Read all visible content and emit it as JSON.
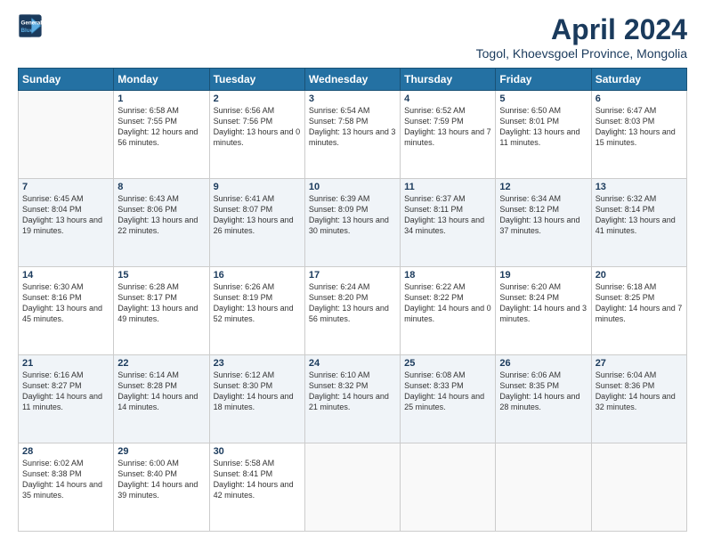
{
  "header": {
    "logo_line1": "General",
    "logo_line2": "Blue",
    "title": "April 2024",
    "subtitle": "Togol, Khoevsgoel Province, Mongolia"
  },
  "days_of_week": [
    "Sunday",
    "Monday",
    "Tuesday",
    "Wednesday",
    "Thursday",
    "Friday",
    "Saturday"
  ],
  "weeks": [
    [
      {
        "day": null
      },
      {
        "day": "1",
        "sunrise": "6:58 AM",
        "sunset": "7:55 PM",
        "daylight": "12 hours and 56 minutes."
      },
      {
        "day": "2",
        "sunrise": "6:56 AM",
        "sunset": "7:56 PM",
        "daylight": "13 hours and 0 minutes."
      },
      {
        "day": "3",
        "sunrise": "6:54 AM",
        "sunset": "7:58 PM",
        "daylight": "13 hours and 3 minutes."
      },
      {
        "day": "4",
        "sunrise": "6:52 AM",
        "sunset": "7:59 PM",
        "daylight": "13 hours and 7 minutes."
      },
      {
        "day": "5",
        "sunrise": "6:50 AM",
        "sunset": "8:01 PM",
        "daylight": "13 hours and 11 minutes."
      },
      {
        "day": "6",
        "sunrise": "6:47 AM",
        "sunset": "8:03 PM",
        "daylight": "13 hours and 15 minutes."
      }
    ],
    [
      {
        "day": "7",
        "sunrise": "6:45 AM",
        "sunset": "8:04 PM",
        "daylight": "13 hours and 19 minutes."
      },
      {
        "day": "8",
        "sunrise": "6:43 AM",
        "sunset": "8:06 PM",
        "daylight": "13 hours and 22 minutes."
      },
      {
        "day": "9",
        "sunrise": "6:41 AM",
        "sunset": "8:07 PM",
        "daylight": "13 hours and 26 minutes."
      },
      {
        "day": "10",
        "sunrise": "6:39 AM",
        "sunset": "8:09 PM",
        "daylight": "13 hours and 30 minutes."
      },
      {
        "day": "11",
        "sunrise": "6:37 AM",
        "sunset": "8:11 PM",
        "daylight": "13 hours and 34 minutes."
      },
      {
        "day": "12",
        "sunrise": "6:34 AM",
        "sunset": "8:12 PM",
        "daylight": "13 hours and 37 minutes."
      },
      {
        "day": "13",
        "sunrise": "6:32 AM",
        "sunset": "8:14 PM",
        "daylight": "13 hours and 41 minutes."
      }
    ],
    [
      {
        "day": "14",
        "sunrise": "6:30 AM",
        "sunset": "8:16 PM",
        "daylight": "13 hours and 45 minutes."
      },
      {
        "day": "15",
        "sunrise": "6:28 AM",
        "sunset": "8:17 PM",
        "daylight": "13 hours and 49 minutes."
      },
      {
        "day": "16",
        "sunrise": "6:26 AM",
        "sunset": "8:19 PM",
        "daylight": "13 hours and 52 minutes."
      },
      {
        "day": "17",
        "sunrise": "6:24 AM",
        "sunset": "8:20 PM",
        "daylight": "13 hours and 56 minutes."
      },
      {
        "day": "18",
        "sunrise": "6:22 AM",
        "sunset": "8:22 PM",
        "daylight": "14 hours and 0 minutes."
      },
      {
        "day": "19",
        "sunrise": "6:20 AM",
        "sunset": "8:24 PM",
        "daylight": "14 hours and 3 minutes."
      },
      {
        "day": "20",
        "sunrise": "6:18 AM",
        "sunset": "8:25 PM",
        "daylight": "14 hours and 7 minutes."
      }
    ],
    [
      {
        "day": "21",
        "sunrise": "6:16 AM",
        "sunset": "8:27 PM",
        "daylight": "14 hours and 11 minutes."
      },
      {
        "day": "22",
        "sunrise": "6:14 AM",
        "sunset": "8:28 PM",
        "daylight": "14 hours and 14 minutes."
      },
      {
        "day": "23",
        "sunrise": "6:12 AM",
        "sunset": "8:30 PM",
        "daylight": "14 hours and 18 minutes."
      },
      {
        "day": "24",
        "sunrise": "6:10 AM",
        "sunset": "8:32 PM",
        "daylight": "14 hours and 21 minutes."
      },
      {
        "day": "25",
        "sunrise": "6:08 AM",
        "sunset": "8:33 PM",
        "daylight": "14 hours and 25 minutes."
      },
      {
        "day": "26",
        "sunrise": "6:06 AM",
        "sunset": "8:35 PM",
        "daylight": "14 hours and 28 minutes."
      },
      {
        "day": "27",
        "sunrise": "6:04 AM",
        "sunset": "8:36 PM",
        "daylight": "14 hours and 32 minutes."
      }
    ],
    [
      {
        "day": "28",
        "sunrise": "6:02 AM",
        "sunset": "8:38 PM",
        "daylight": "14 hours and 35 minutes."
      },
      {
        "day": "29",
        "sunrise": "6:00 AM",
        "sunset": "8:40 PM",
        "daylight": "14 hours and 39 minutes."
      },
      {
        "day": "30",
        "sunrise": "5:58 AM",
        "sunset": "8:41 PM",
        "daylight": "14 hours and 42 minutes."
      },
      {
        "day": null
      },
      {
        "day": null
      },
      {
        "day": null
      },
      {
        "day": null
      }
    ]
  ]
}
